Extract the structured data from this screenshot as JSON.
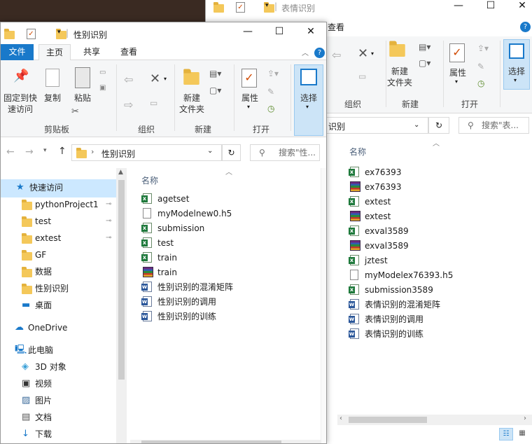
{
  "back_window": {
    "title": "表情识别",
    "tab_view": "查看",
    "groups": {
      "organize": "组织",
      "new": "新建",
      "open": "打开"
    },
    "buttons": {
      "new_folder": "新建\n文件夹",
      "properties": "属性",
      "select": "选择"
    },
    "address_tail": "识别",
    "search_placeholder": "搜索\"表...",
    "column_name": "名称",
    "files": [
      {
        "name": "ex76393",
        "icon": "excel-csv-icon"
      },
      {
        "name": "ex76393",
        "icon": "winrar-icon"
      },
      {
        "name": "extest",
        "icon": "excel-csv-icon"
      },
      {
        "name": "extest",
        "icon": "winrar-icon"
      },
      {
        "name": "exval3589",
        "icon": "excel-csv-icon"
      },
      {
        "name": "exval3589",
        "icon": "winrar-icon"
      },
      {
        "name": "jztest",
        "icon": "excel-csv-icon"
      },
      {
        "name": "myModelex76393.h5",
        "icon": "generic-file-icon"
      },
      {
        "name": "submission3589",
        "icon": "excel-csv-icon"
      },
      {
        "name": "表情识别的混淆矩阵",
        "icon": "word-doc-icon"
      },
      {
        "name": "表情识别的调用",
        "icon": "word-doc-icon"
      },
      {
        "name": "表情识别的训练",
        "icon": "word-doc-icon"
      }
    ]
  },
  "front_window": {
    "title": "性别识别",
    "tabs": {
      "file": "文件",
      "home": "主页",
      "share": "共享",
      "view": "查看"
    },
    "clipboard": {
      "pin": "固定到快\n速访问",
      "copy": "复制",
      "paste": "粘贴",
      "group": "剪贴板"
    },
    "groups": {
      "organize": "组织",
      "new": "新建",
      "open": "打开"
    },
    "buttons": {
      "new_folder": "新建\n文件夹",
      "properties": "属性",
      "select": "选择"
    },
    "address": "性别识别",
    "search_placeholder": "搜索\"性...",
    "column_name": "名称",
    "nav": {
      "quick_access": "快速访问",
      "pinned": [
        "pythonProject1",
        "test",
        "extest"
      ],
      "folders": [
        "GF",
        "数据",
        "性别识别"
      ],
      "desktop": "桌面",
      "onedrive": "OneDrive",
      "this_pc": "此电脑",
      "pc_items": [
        "3D 对象",
        "视频",
        "图片",
        "文档",
        "下载"
      ]
    },
    "files": [
      {
        "name": "agetset",
        "icon": "excel-csv-icon"
      },
      {
        "name": "myModelnew0.h5",
        "icon": "generic-file-icon"
      },
      {
        "name": "submission",
        "icon": "excel-csv-icon"
      },
      {
        "name": "test",
        "icon": "excel-csv-icon"
      },
      {
        "name": "train",
        "icon": "excel-csv-icon"
      },
      {
        "name": "train",
        "icon": "winrar-icon"
      },
      {
        "name": "性别识别的混淆矩阵",
        "icon": "word-doc-icon"
      },
      {
        "name": "性别识别的调用",
        "icon": "word-doc-icon"
      },
      {
        "name": "性别识别的训练",
        "icon": "word-doc-icon"
      }
    ],
    "date_col_glyph": "2"
  },
  "colors": {
    "accent": "#1979ca",
    "selected_nav": "#cce8ff",
    "ribbon_bg": "#f5f6f7",
    "select_btn": "#cce4f7"
  }
}
